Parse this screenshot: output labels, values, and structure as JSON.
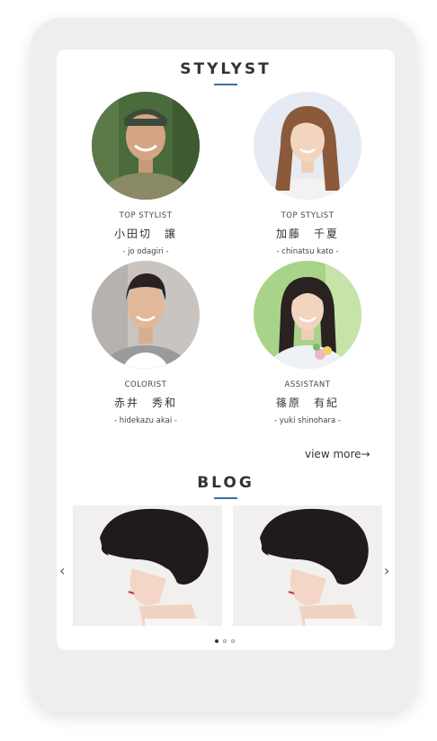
{
  "stylist_section": {
    "title": "STYLYST",
    "stylists": [
      {
        "role": "TOP STYLIST",
        "name": "小田切　譲",
        "romaji": "- jo odagiri -"
      },
      {
        "role": "TOP STYLIST",
        "name": "加藤　千夏",
        "romaji": "- chinatsu kato -"
      },
      {
        "role": "COLORIST",
        "name": "赤井　秀和",
        "romaji": "- hidekazu akai -"
      },
      {
        "role": "ASSISTANT",
        "name": "篠原　有紀",
        "romaji": "- yuki shinohara -"
      }
    ],
    "view_more": "view more→"
  },
  "blog_section": {
    "title": "BLOG",
    "prev_icon": "chevron-left-icon",
    "next_icon": "chevron-right-icon",
    "prev_glyph": "‹",
    "next_glyph": "›",
    "dot_count": 3,
    "active_dot": 1
  },
  "colors": {
    "accent_underline": "#3d6fa6"
  }
}
